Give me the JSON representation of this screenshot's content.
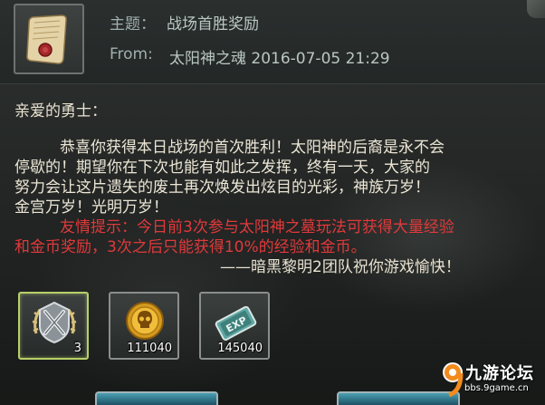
{
  "header": {
    "subject_label": "主题：",
    "subject": "战场首胜奖励",
    "from_label": "From:",
    "from": "太阳神之魂 2016-07-05 21:29",
    "icon": "scroll-letter-icon"
  },
  "body": {
    "greeting": "亲爱的勇士：",
    "lines": [
      "恭喜你获得本日战场的首次胜利！太阳神的后裔是永不会",
      "停歇的！期望你在下次也能有如此之发挥，终有一天，大家的",
      "努力会让这片遗失的废土再次焕发出炫目的光彩，神族万岁！",
      "金宫万岁！光明万岁！"
    ],
    "tip_lines": [
      "友情提示：今日前3次参与太阳神之墓玩法可获得大量经验",
      "和金币奖励，3次之后只能获得10%的经验和金币。"
    ],
    "signature": "——暗黑黎明2团队祝你游戏愉快！"
  },
  "rewards": [
    {
      "icon": "crossed-swords-medal-icon",
      "count": "3",
      "selected": true
    },
    {
      "icon": "gold-skull-coin-icon",
      "count": "111040",
      "selected": false
    },
    {
      "icon": "exp-scroll-icon",
      "count": "145040",
      "selected": false
    }
  ],
  "watermark": {
    "logo_text": "九游论坛",
    "url": "bbs.9game.cn"
  },
  "colors": {
    "tip_red": "#e0393b",
    "body_text": "#ece6d6",
    "header_text": "#9fb0ad",
    "selected_border": "#b7d06a",
    "button_teal": "#2e7084"
  }
}
